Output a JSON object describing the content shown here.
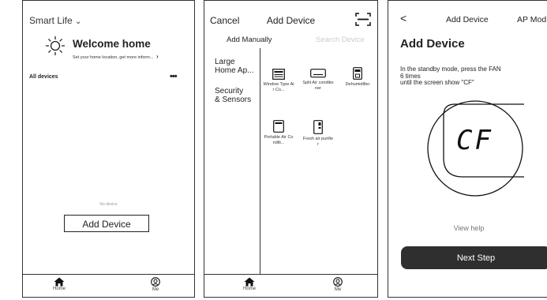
{
  "screen1": {
    "title": "Smart Life",
    "title_chevron": "⌄",
    "welcome_title": "Welcome home",
    "welcome_subtitle": "Set your home location, get more inform...",
    "subtitle_arrow": "›",
    "all_devices": "All devices",
    "more_menu": "•••",
    "empty_text": "No device",
    "add_device_button": "Add Device",
    "tabs": {
      "home": "Home",
      "me": "Me"
    }
  },
  "screen2": {
    "cancel": "Cancel",
    "title": "Add Device",
    "tab_manual": "Add Manually",
    "tab_search": "Search Device",
    "categories": [
      {
        "line1": "Large",
        "line2": "Home Ap..."
      },
      {
        "line1": "Security",
        "line2": "& Sensors"
      }
    ],
    "devices": [
      "Window Type Air Co...",
      "Split Air conditioner",
      "Dehumidifier",
      "Portable Air Conditi...",
      "Fresh air purifier"
    ],
    "tabs": {
      "home": "Home",
      "me": "Me"
    }
  },
  "screen3": {
    "back": "<",
    "title": "Add Device",
    "mode": "AP Mod",
    "heading": "Add Device",
    "instruction_line1": "In the standby mode, press the FAN",
    "instruction_line2": "6 times",
    "instruction_line3": "until the screen show \"CF\"",
    "display_text": "CF",
    "view_help": "View help",
    "next_button": "Next Step"
  },
  "icons": {
    "sun": "sun-icon",
    "scan": "scan-icon",
    "home": "home-icon",
    "me": "me-icon"
  },
  "colors": {
    "button_dark": "#2f2f2f",
    "muted": "#999999",
    "inactive_tab": "#cccccc"
  }
}
